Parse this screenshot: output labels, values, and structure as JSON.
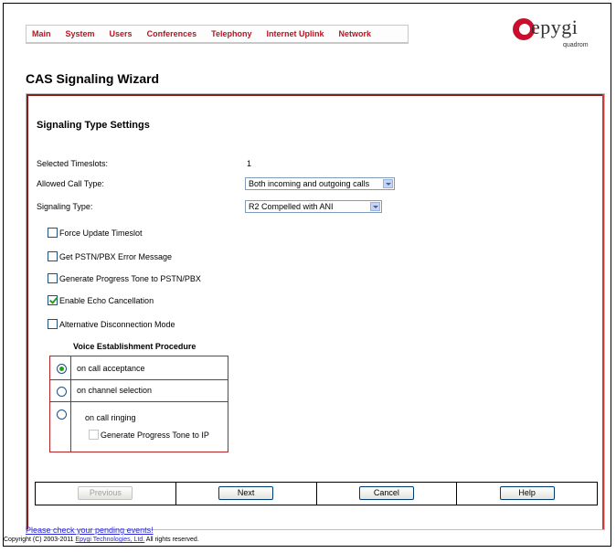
{
  "nav": {
    "items": [
      "Main",
      "System",
      "Users",
      "Conferences",
      "Telephony",
      "Internet Uplink",
      "Network"
    ]
  },
  "logo": {
    "name": "epygi",
    "sub": "quadrom"
  },
  "page_title": "CAS Signaling Wizard",
  "section_title": "Signaling Type Settings",
  "fields": {
    "timeslots_label": "Selected Timeslots:",
    "timeslots_value": "1",
    "call_type_label": "Allowed Call Type:",
    "call_type_value": "Both incoming and outgoing calls",
    "signaling_label": "Signaling Type:",
    "signaling_value": "R2 Compelled with ANI"
  },
  "checkboxes": [
    {
      "label": "Force Update Timeslot",
      "checked": false
    },
    {
      "label": "Get PSTN/PBX Error Message",
      "checked": false
    },
    {
      "label": "Generate Progress Tone to PSTN/PBX",
      "checked": false
    },
    {
      "label": "Enable Echo Cancellation",
      "checked": true
    },
    {
      "label": "Alternative Disconnection Mode",
      "checked": false
    }
  ],
  "vep": {
    "title": "Voice Establishment Procedure",
    "options": [
      {
        "label": "on call acceptance",
        "selected": true
      },
      {
        "label": "on channel selection",
        "selected": false
      },
      {
        "label": "on call ringing",
        "selected": false
      }
    ],
    "sub_option": "Generate Progress Tone to IP"
  },
  "buttons": {
    "previous": "Previous",
    "next": "Next",
    "cancel": "Cancel",
    "help": "Help"
  },
  "footer": {
    "events_link": "Please check your pending events!",
    "copyright_prefix": "Copyright (C) 2003-2011 ",
    "company": "Epygi Technologies, Ltd.",
    "copyright_suffix": " All rights reserved."
  },
  "colors": {
    "accent": "#b8141f",
    "panel_border": "#8b1a1a",
    "link": "#2b2bd6"
  }
}
